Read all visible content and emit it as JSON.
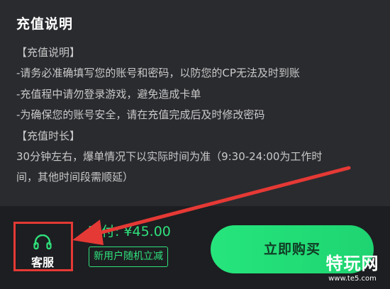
{
  "header": {
    "title": "充值说明"
  },
  "description": {
    "lines": [
      "【充值说明】",
      "-请务必准确填写您的账号和密码，以防您的CP无法及时到账",
      "-充值程中请勿登录游戏，避免造成卡单",
      "-为确保您的账号安全，请在充值完成后及时修改密码",
      "【充值时长】",
      "30分钟左右，爆单情况下以实际时间为准（9:30-24:00为工作时",
      "间，其他时间段需顺延）"
    ]
  },
  "footer": {
    "customer_service_label": "客服",
    "customer_service_icon": "headset-icon",
    "price_label": "实付:",
    "price_value": "¥45.00",
    "coupon_label": "新用户随机立减",
    "buy_button_label": "立即购买"
  },
  "watermark": {
    "main": "特玩网",
    "sub": "www.te5.com"
  },
  "colors": {
    "accent_green": "#2fe07c",
    "annotation_red": "#e53935",
    "panel_bg": "#2a2b2f",
    "footer_bg": "#1d1e21"
  }
}
